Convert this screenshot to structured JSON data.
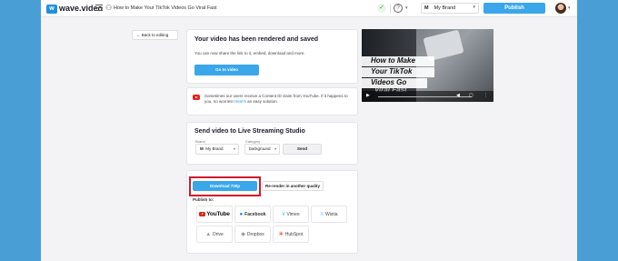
{
  "topbar": {
    "logo_mark": "w",
    "logo_text": "wave.video",
    "project_title": "How to Make Your TikTok Videos Go Viral Fast",
    "check": "✓",
    "help": "?",
    "brand_initial": "M",
    "brand_name": "My Brand",
    "publish_label": "Publish"
  },
  "back_label": "← Back to editing",
  "rendered": {
    "title": "Your video has been rendered and saved",
    "description": "You can now share the link to it, embed, download and more.",
    "go_label": "Go to video"
  },
  "notice": {
    "text": "Sometimes our users receive a Content ID claim from YouTube. If it happens to you, no worries! ",
    "link": "Here's",
    "text_after": " an easy solution."
  },
  "live": {
    "title": "Send video to Live Streaming Studio",
    "brand_label": "Brand",
    "brand_initial": "M",
    "brand_value": "My Brand",
    "category_label": "Category",
    "category_value": "background",
    "send_label": "Send"
  },
  "download": {
    "download_label": "Download 720p",
    "rerender_label": "Re-render in another quality",
    "publish_to": "Publish to:",
    "targets": [
      {
        "label": "YouTube",
        "icon": "youtube-icon"
      },
      {
        "label": "Facebook",
        "icon": "facebook-icon"
      },
      {
        "label": "Vimeo",
        "icon": "vimeo-icon"
      },
      {
        "label": "Wistia",
        "icon": "wistia-icon"
      },
      {
        "label": "Drive",
        "icon": "drive-icon"
      },
      {
        "label": "Dropbox",
        "icon": "dropbox-icon"
      },
      {
        "label": "HubSpot",
        "icon": "hubspot-icon"
      }
    ]
  },
  "video": {
    "line1": "How to Make",
    "line2": "Your TikTok",
    "line3": "Videos Go",
    "line4": "Viral Fast"
  },
  "colors": {
    "accent": "#39a7ea",
    "background": "#4a9ed6",
    "highlight": "#d3192c"
  }
}
